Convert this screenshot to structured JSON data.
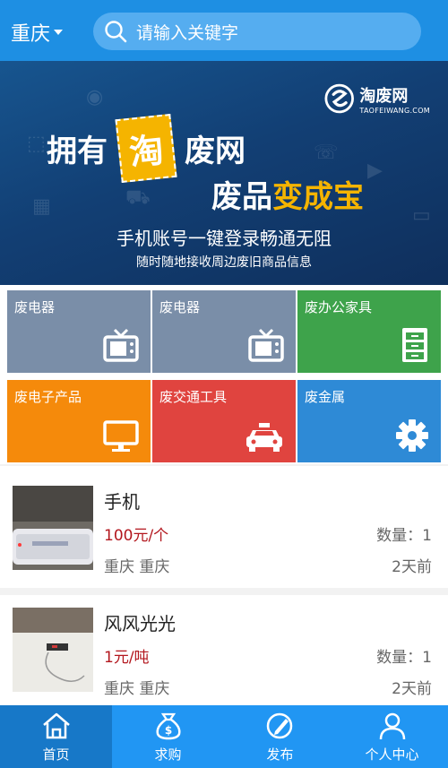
{
  "header": {
    "city": "重庆",
    "search_placeholder": "请输入关键字"
  },
  "banner": {
    "brand_cn": "淘废网",
    "brand_en": "TAOFEIWANG.COM",
    "line1_a": "拥有",
    "line1_b": "淘",
    "line1_c": "废网",
    "line2_a": "废品",
    "line2_b": "变成宝",
    "sub1": "手机账号一键登录畅通无阻",
    "sub2": "随时随地接收周边废旧商品信息"
  },
  "categories": [
    {
      "label": "废电器",
      "icon": "tv-icon",
      "color": "#7a8ea8"
    },
    {
      "label": "废电器",
      "icon": "tv-icon",
      "color": "#7a8ea8"
    },
    {
      "label": "废办公家具",
      "icon": "cabinet-icon",
      "color": "#3ea34b"
    },
    {
      "label": "废电子产品",
      "icon": "monitor-icon",
      "color": "#f58a0b"
    },
    {
      "label": "废交通工具",
      "icon": "car-icon",
      "color": "#e0443f"
    },
    {
      "label": "废金属",
      "icon": "gear-icon",
      "color": "#2e8ad6"
    }
  ],
  "items": [
    {
      "name": "手机",
      "price": "100元/个",
      "qty": "数量：1",
      "location": "重庆 重庆",
      "time": "2天前"
    },
    {
      "name": "风风光光",
      "price": "1元/吨",
      "qty": "数量：1",
      "location": "重庆 重庆",
      "time": "2天前"
    }
  ],
  "nav": [
    {
      "label": "首页",
      "icon": "home-icon",
      "active": true
    },
    {
      "label": "求购",
      "icon": "money-bag-icon",
      "active": false
    },
    {
      "label": "发布",
      "icon": "publish-icon",
      "active": false
    },
    {
      "label": "个人中心",
      "icon": "user-icon",
      "active": false
    }
  ],
  "colors": {
    "header": "#1e8fe3",
    "nav": "#2196f3",
    "nav_active": "#1778c8",
    "price": "#b3171e"
  }
}
